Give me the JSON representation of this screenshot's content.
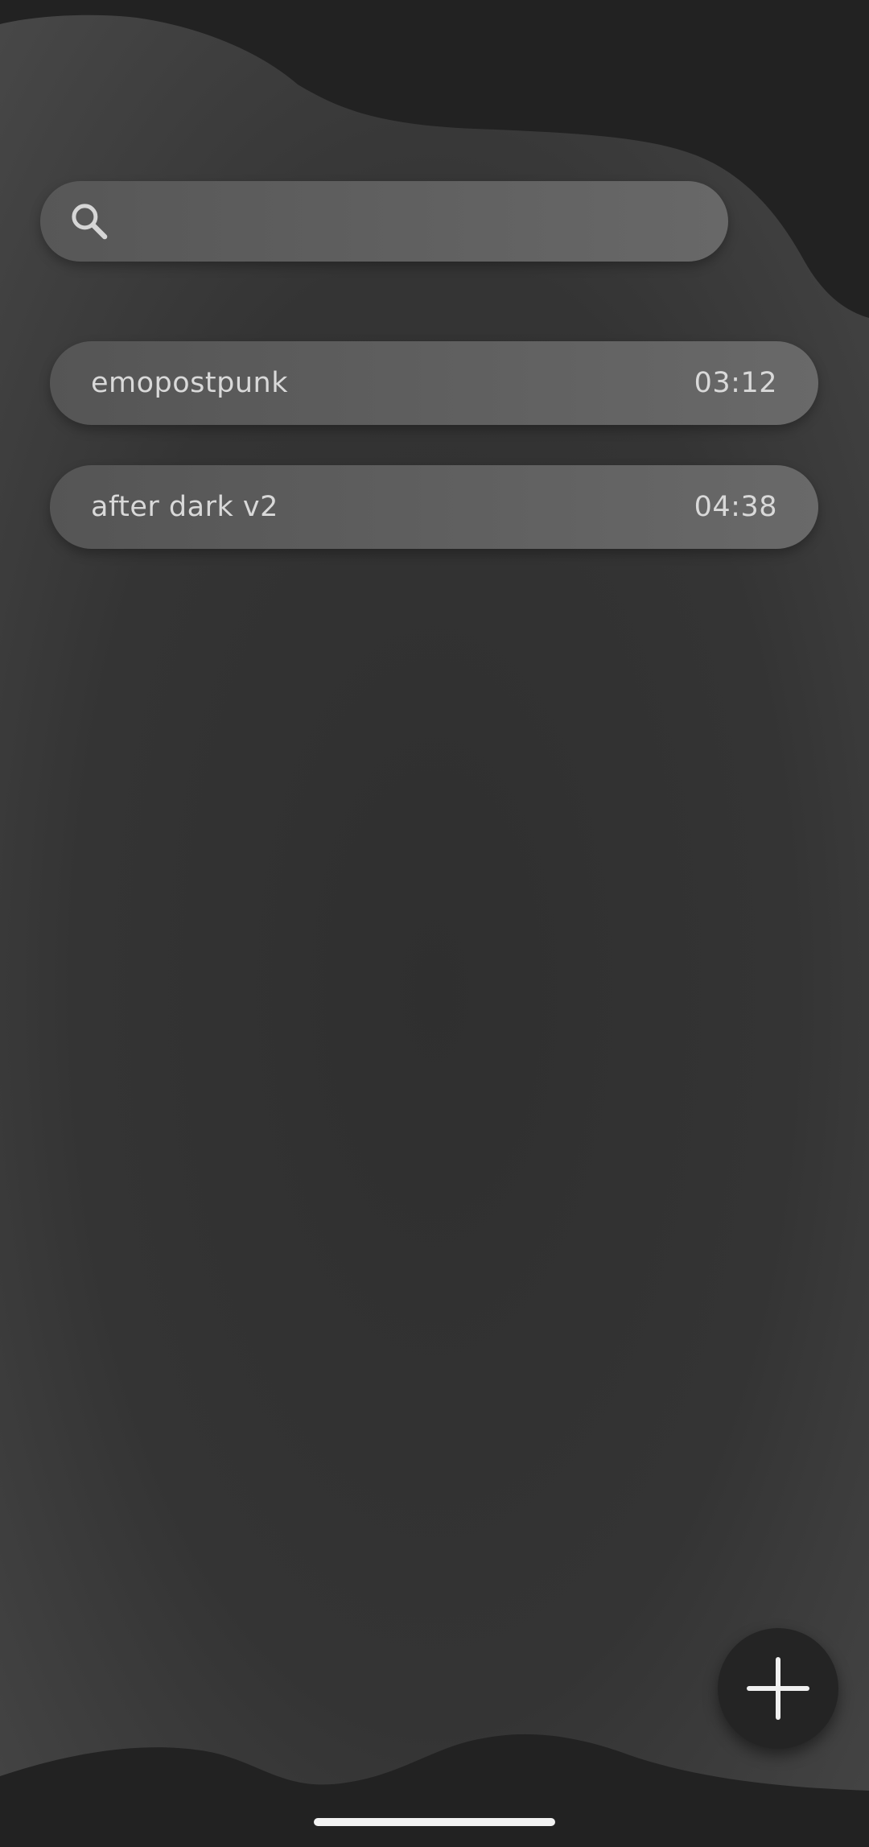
{
  "search": {
    "placeholder": "",
    "value": "",
    "icon": "search-icon"
  },
  "recordings": [
    {
      "title": "emopostpunk",
      "duration": "03:12"
    },
    {
      "title": "after dark v2",
      "duration": "04:38"
    }
  ],
  "fab": {
    "icon": "plus-icon"
  },
  "colors": {
    "background_dark": "#222222",
    "panel_gradient_light": "#474747",
    "panel_gradient_mid": "#303030",
    "item_fill": "#636363",
    "text": "#d9d9d9",
    "fab_fill": "#242424"
  }
}
